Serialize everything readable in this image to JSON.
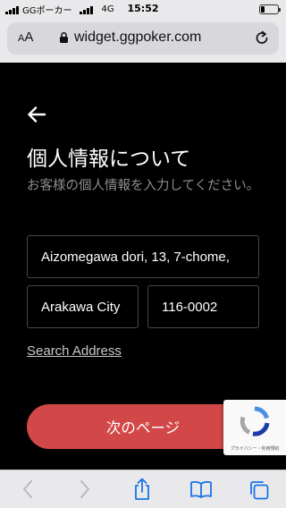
{
  "status_bar": {
    "carrier": "GGポーカー",
    "network": "4G",
    "time": "15:52"
  },
  "browser": {
    "text_size_label_small": "A",
    "text_size_label_large": "A",
    "url": "widget.ggpoker.com"
  },
  "page": {
    "title": "個人情報について",
    "subtitle": "お客様の個人情報を入力してください。",
    "address_line": "Aizomegawa dori, 13, 7-chome,",
    "city": "Arakawa City",
    "postal_code": "116-0002",
    "search_address_link": "Search Address",
    "next_button": "次のページ"
  },
  "recaptcha": {
    "privacy_text": "プライバシー・利用規約"
  },
  "colors": {
    "accent": "#d24848",
    "background": "#000000",
    "toolbar_icon": "#1a73e8",
    "toolbar_disabled": "#b9b9be"
  },
  "icons": {
    "back": "arrow-left-icon",
    "lock": "lock-icon",
    "reload": "reload-icon",
    "share": "share-icon",
    "bookmarks": "book-icon",
    "tabs": "tabs-icon"
  }
}
